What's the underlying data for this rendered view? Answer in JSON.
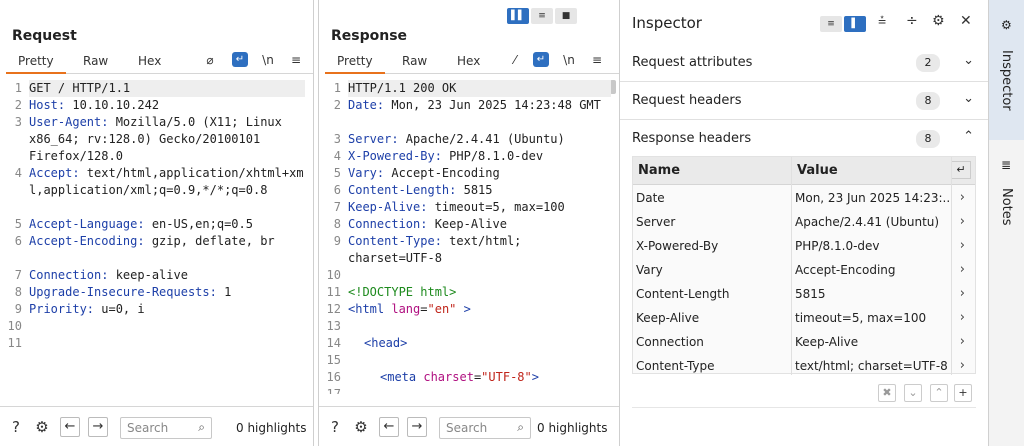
{
  "request": {
    "title": "Request",
    "tabs": [
      "Pretty",
      "Raw",
      "Hex"
    ],
    "lines": [
      {
        "n": "1",
        "k": "GET / HTTP/1.1",
        "v": ""
      },
      {
        "n": "2",
        "k": "Host:",
        "v": " 10.10.10.242"
      },
      {
        "n": "3",
        "k": "User-Agent:",
        "v": " Mozilla/5.0 (X11; Linux x86_64; rv:128.0) Gecko/20100101 Firefox/128.0"
      },
      {
        "n": "4",
        "k": "Accept:",
        "v": " text/html,application/xhtml+xml,application/xml;q=0.9,*/*;q=0.8"
      },
      {
        "n": "5",
        "k": "Accept-Language:",
        "v": " en-US,en;q=0.5"
      },
      {
        "n": "6",
        "k": "Accept-Encoding:",
        "v": " gzip, deflate, br"
      },
      {
        "n": "7",
        "k": "Connection:",
        "v": " keep-alive"
      },
      {
        "n": "8",
        "k": "Upgrade-Insecure-Requests:",
        "v": " 1"
      },
      {
        "n": "9",
        "k": "Priority:",
        "v": " u=0, i"
      },
      {
        "n": "10",
        "k": "",
        "v": ""
      },
      {
        "n": "11",
        "k": "",
        "v": ""
      }
    ],
    "search_placeholder": "Search",
    "highlights": "0 highlights"
  },
  "response": {
    "title": "Response",
    "tabs": [
      "Pretty",
      "Raw",
      "Hex"
    ],
    "lines": [
      {
        "n": "1",
        "k": "HTTP/1.1 200 OK",
        "v": ""
      },
      {
        "n": "2",
        "k": "Date:",
        "v": " Mon, 23 Jun 2025 14:23:48 GMT"
      },
      {
        "n": "3",
        "k": "Server:",
        "v": " Apache/2.4.41 (Ubuntu)"
      },
      {
        "n": "4",
        "k": "X-Powered-By:",
        "v": " PHP/8.1.0-dev"
      },
      {
        "n": "5",
        "k": "Vary:",
        "v": " Accept-Encoding"
      },
      {
        "n": "6",
        "k": "Content-Length:",
        "v": " 5815"
      },
      {
        "n": "7",
        "k": "Keep-Alive:",
        "v": " timeout=5, max=100"
      },
      {
        "n": "8",
        "k": "Connection:",
        "v": " Keep-Alive"
      },
      {
        "n": "9",
        "k": "Content-Type:",
        "v": " text/html; charset=UTF-8"
      }
    ],
    "html": {
      "n10": "10",
      "n11": "11",
      "doctype": "<!DOCTYPE html>",
      "n12": "12",
      "html_open": "<html",
      "lang_attr": "lang",
      "lang_val": "\"en\"",
      "gt": " >",
      "n13": "13",
      "n14": "14",
      "head": "<head>",
      "n15": "15",
      "n16": "16",
      "meta": "<meta",
      "charset_attr": "charset",
      "charset_val": "\"UTF-8\"",
      "meta_end": ">",
      "n17": "17"
    },
    "search_placeholder": "Search",
    "highlights": "0 highlights"
  },
  "inspector": {
    "title": "Inspector",
    "sections": [
      {
        "label": "Request attributes",
        "count": "2"
      },
      {
        "label": "Request headers",
        "count": "8"
      },
      {
        "label": "Response headers",
        "count": "8"
      }
    ],
    "columns": [
      "Name",
      "Value"
    ],
    "rows": [
      {
        "name": "Date",
        "value": "Mon, 23 Jun 2025 14:23:..."
      },
      {
        "name": "Server",
        "value": "Apache/2.4.41 (Ubuntu)"
      },
      {
        "name": "X-Powered-By",
        "value": "PHP/8.1.0-dev"
      },
      {
        "name": "Vary",
        "value": "Accept-Encoding"
      },
      {
        "name": "Content-Length",
        "value": "5815"
      },
      {
        "name": "Keep-Alive",
        "value": "timeout=5, max=100"
      },
      {
        "name": "Connection",
        "value": "Keep-Alive"
      },
      {
        "name": "Content-Type",
        "value": "text/html; charset=UTF-8"
      }
    ]
  },
  "sidebar": {
    "inspector": "Inspector",
    "notes": "Notes"
  },
  "accent": "#e8721c",
  "selected_blue": "#2e6fc0"
}
